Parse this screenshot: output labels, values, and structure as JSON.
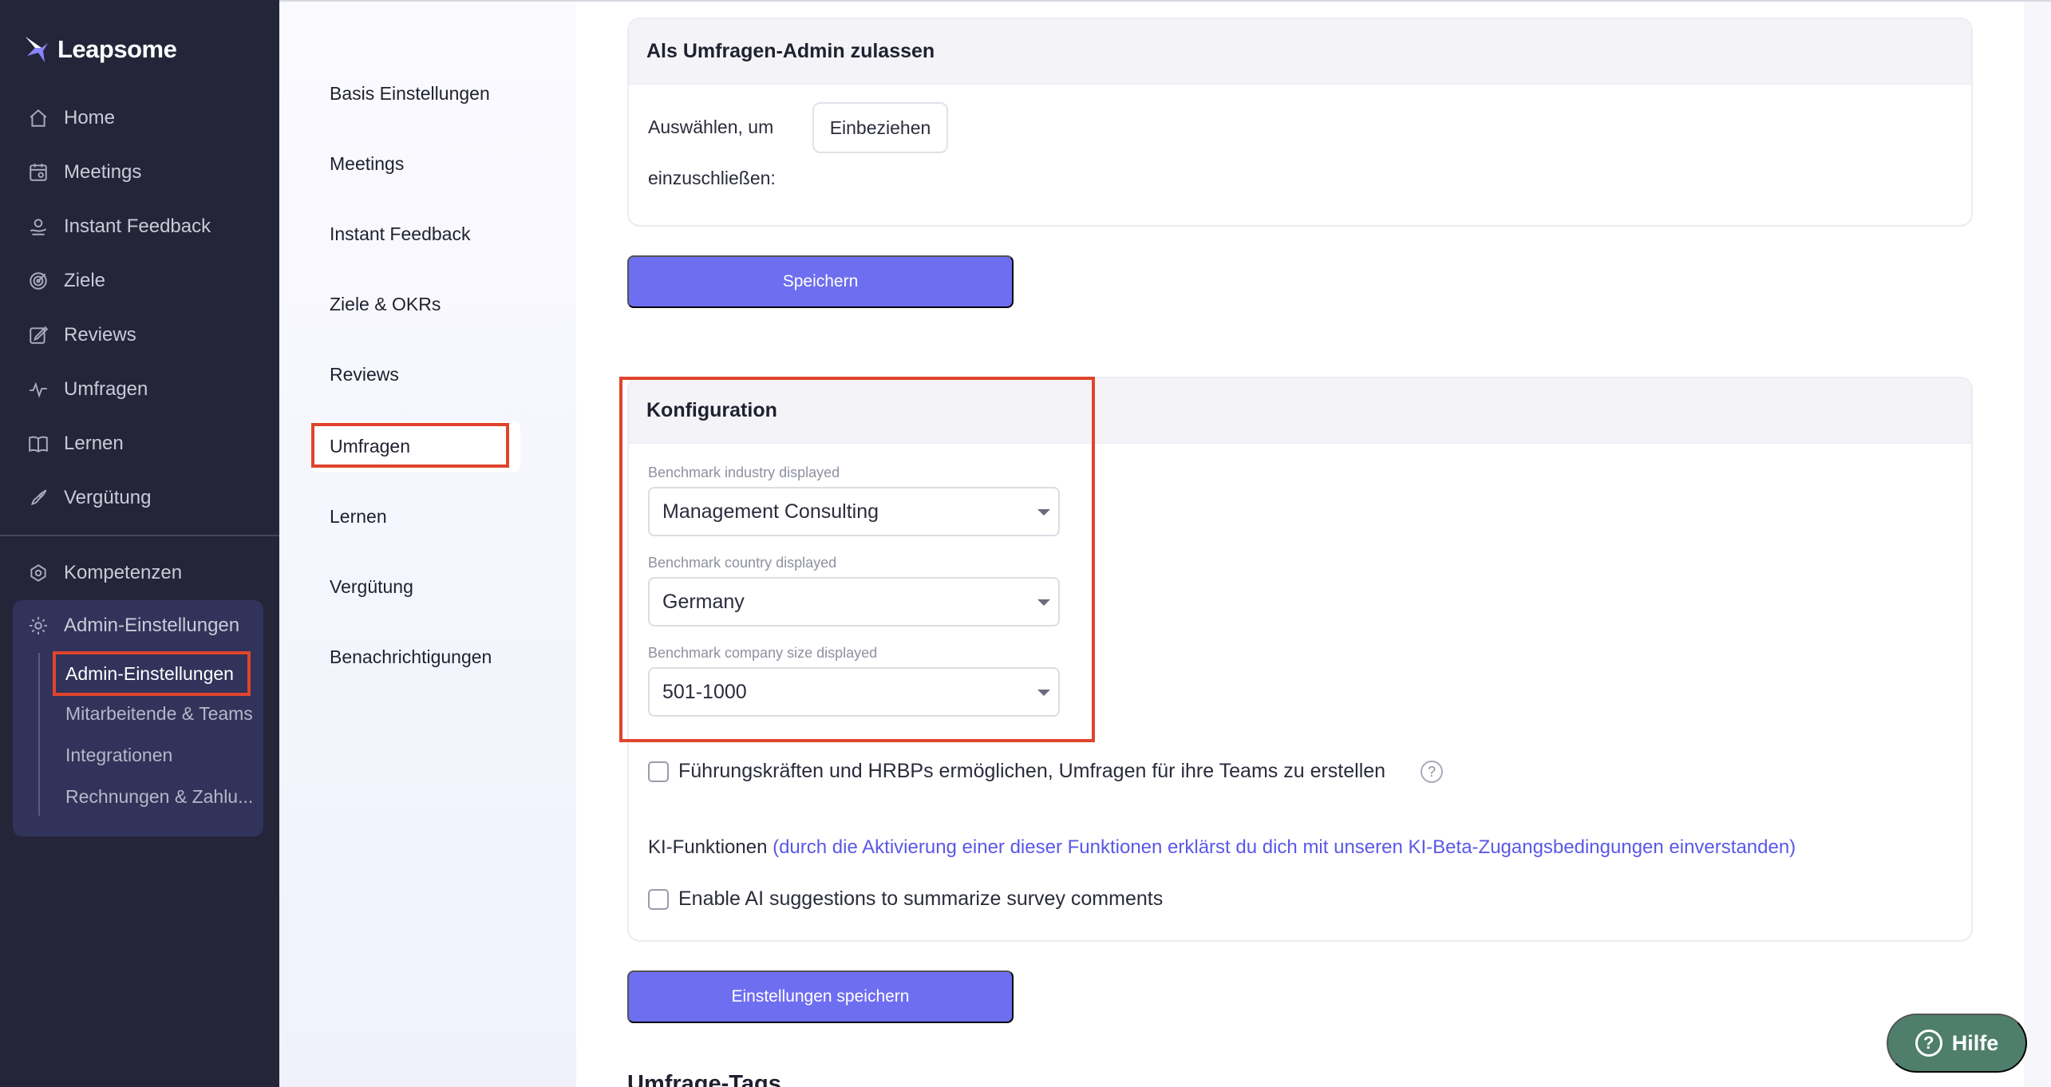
{
  "brand": {
    "name": "Leapsome"
  },
  "sidebar": {
    "items": [
      {
        "label": "Home",
        "icon": "home-icon"
      },
      {
        "label": "Meetings",
        "icon": "meetings-icon"
      },
      {
        "label": "Instant Feedback",
        "icon": "feedback-icon"
      },
      {
        "label": "Ziele",
        "icon": "target-icon"
      },
      {
        "label": "Reviews",
        "icon": "edit-icon"
      },
      {
        "label": "Umfragen",
        "icon": "pulse-icon"
      },
      {
        "label": "Lernen",
        "icon": "book-icon"
      },
      {
        "label": "Vergütung",
        "icon": "rocket-icon"
      },
      {
        "label": "Kompetenzen",
        "icon": "network-icon"
      },
      {
        "label": "Admin-Einstellungen",
        "icon": "gear-icon"
      }
    ],
    "admin_sub": [
      {
        "label": "Admin-Einstellungen"
      },
      {
        "label": "Mitarbeitende & Teams"
      },
      {
        "label": "Integrationen"
      },
      {
        "label": "Rechnungen & Zahlu..."
      }
    ]
  },
  "settings_menu": {
    "items": [
      {
        "label": "Basis Einstellungen"
      },
      {
        "label": "Meetings"
      },
      {
        "label": "Instant Feedback"
      },
      {
        "label": "Ziele & OKRs"
      },
      {
        "label": "Reviews"
      },
      {
        "label": "Umfragen"
      },
      {
        "label": "Lernen"
      },
      {
        "label": "Vergütung"
      },
      {
        "label": "Benachrichtigungen"
      }
    ]
  },
  "admin_card": {
    "title": "Als Umfragen-Admin zulassen",
    "select_label_line1": "Auswählen, um",
    "select_label_line2": "einzuschließen:",
    "include_button": "Einbeziehen",
    "save_button": "Speichern"
  },
  "config_card": {
    "title": "Konfiguration",
    "industry_label": "Benchmark industry displayed",
    "industry_value": "Management Consulting",
    "country_label": "Benchmark country displayed",
    "country_value": "Germany",
    "size_label": "Benchmark company size displayed",
    "size_value": "501-1000",
    "managers_checkbox_label": "Führungskräften und HRBPs ermöglichen, Umfragen für ihre Teams zu erstellen",
    "managers_checked": false,
    "ki_title": "KI-Funktionen",
    "ki_link": "(durch die Aktivierung einer dieser Funktionen erklärst du dich mit unseren KI-Beta-Zugangsbedingungen einverstanden)",
    "ai_checkbox_label": "Enable AI suggestions to summarize survey comments",
    "ai_checked": false,
    "save_settings_button": "Einstellungen speichern"
  },
  "next_section_title": "Umfrage-Tags",
  "help_button": "Hilfe",
  "colors": {
    "sidebar_bg": "#242539",
    "primary": "#6e6ef0",
    "highlight": "#e0442c",
    "link": "#5b58e6",
    "help_bg": "#4f7f6c"
  }
}
